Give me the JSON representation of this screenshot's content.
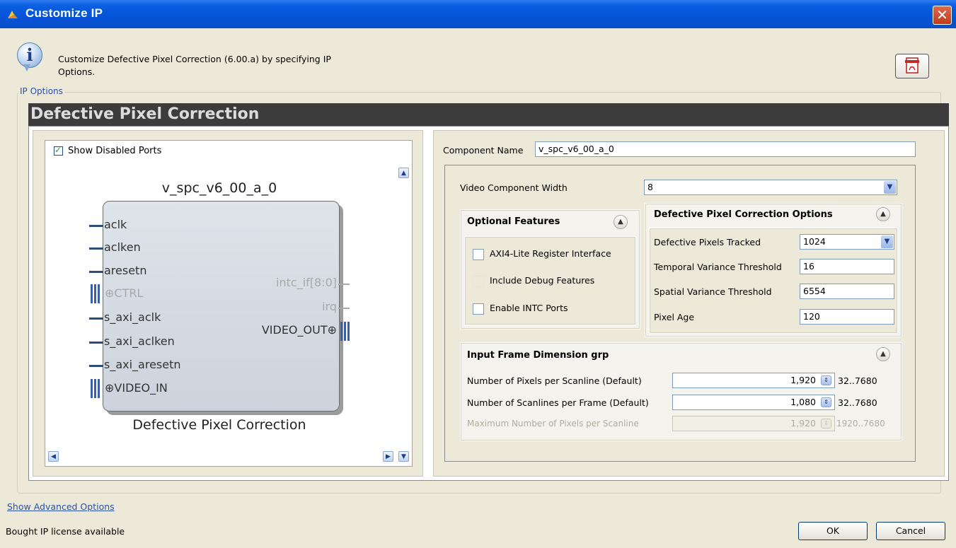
{
  "window": {
    "title": "Customize IP",
    "close_glyph": "✕"
  },
  "header": {
    "description": "Customize Defective Pixel Correction (6.00.a) by specifying IP Options.",
    "info_icon": "info-icon",
    "pdf_icon": "pdf-icon"
  },
  "group": {
    "label": "IP Options",
    "banner": "Defective Pixel Correction"
  },
  "symbol": {
    "show_disabled_ports_label": "Show Disabled Ports",
    "show_disabled_ports_checked": true,
    "instance_name": "v_spc_v6_00_a_0",
    "footer_name": "Defective Pixel Correction",
    "left_ports": [
      "aclk",
      "aclken",
      "aresetn",
      "CTRL",
      "s_axi_aclk",
      "s_axi_aclken",
      "s_axi_aresetn",
      "VIDEO_IN"
    ],
    "right_ports": [
      "intc_if[8:0]",
      "irq",
      "VIDEO_OUT"
    ]
  },
  "config": {
    "component_name_label": "Component Name",
    "component_name_value": "v_spc_v6_00_a_0",
    "video_width_label": "Video Component Width",
    "video_width_value": "8",
    "optional_features": {
      "title": "Optional Features",
      "axi4_label": "AXI4-Lite Register Interface",
      "debug_label": "Include Debug Features",
      "intc_label": "Enable INTC Ports"
    },
    "dpc_options": {
      "title": "Defective Pixel Correction Options",
      "tracked_label": "Defective Pixels Tracked",
      "tracked_value": "1024",
      "temporal_label": "Temporal Variance Threshold",
      "temporal_value": "16",
      "spatial_label": "Spatial Variance Threshold",
      "spatial_value": "6554",
      "age_label": "Pixel Age",
      "age_value": "120"
    },
    "frame_dim": {
      "title": "Input Frame Dimension grp",
      "pixels_label": "Number of Pixels per Scanline (Default)",
      "pixels_value": "1,920",
      "pixels_range": "32..7680",
      "scanlines_label": "Number of Scanlines per Frame (Default)",
      "scanlines_value": "1,080",
      "scanlines_range": "32..7680",
      "max_label": "Maximum Number of Pixels per Scanline",
      "max_value": "1,920",
      "max_range": "1920..7680"
    }
  },
  "footer": {
    "advanced_link": "Show Advanced Options",
    "status": "Bought IP license available",
    "ok_label": "OK",
    "cancel_label": "Cancel"
  }
}
